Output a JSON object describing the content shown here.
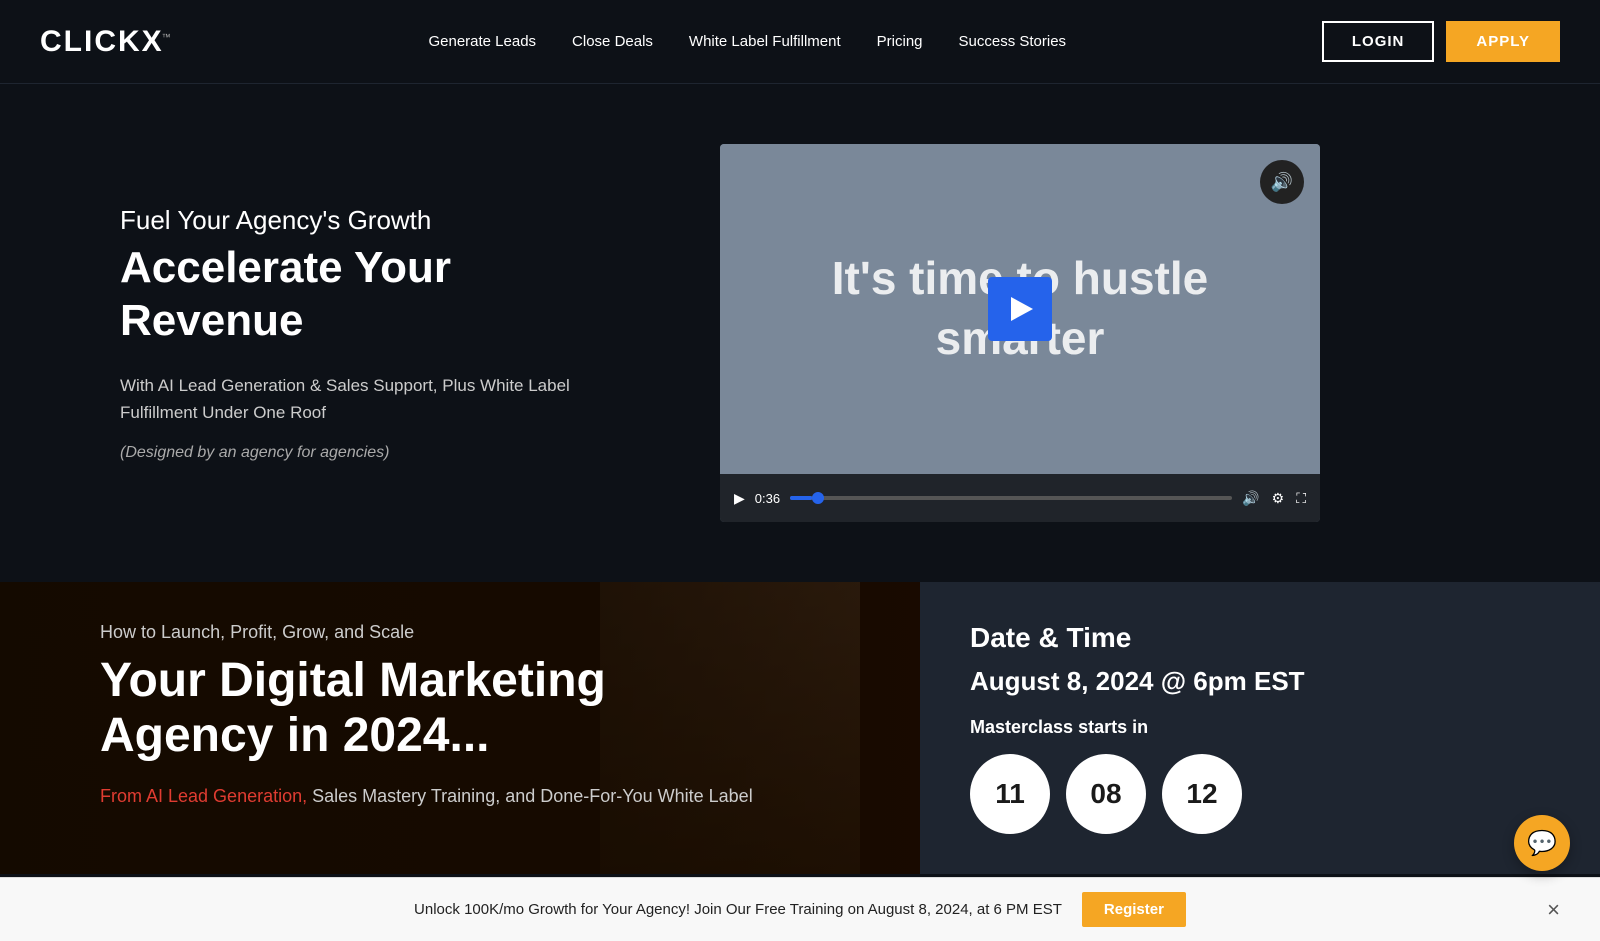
{
  "navbar": {
    "logo": "CLICKX",
    "logo_tm": "™",
    "nav_links": [
      {
        "label": "Generate Leads",
        "id": "generate-leads"
      },
      {
        "label": "Close Deals",
        "id": "close-deals"
      },
      {
        "label": "White Label Fulfillment",
        "id": "white-label"
      },
      {
        "label": "Pricing",
        "id": "pricing"
      },
      {
        "label": "Success Stories",
        "id": "success-stories"
      }
    ],
    "login_label": "LOGIN",
    "apply_label": "APPLY"
  },
  "hero": {
    "subtitle": "Fuel Your Agency's Growth",
    "title": "Accelerate Your Revenue",
    "description": "With AI Lead Generation & Sales Support, Plus White Label Fulfillment Under One Roof",
    "tagline": "(Designed by an agency for agencies)"
  },
  "video": {
    "text_line1": "It's time to hustle",
    "text_line2": "smarter",
    "time": "0:36",
    "mute_icon": "🔊"
  },
  "lower": {
    "pre_title": "How to Launch, Profit, Grow, and Scale",
    "main_title_line1": "Your Digital Marketing",
    "main_title_line2": "Agency in 2024...",
    "highlight_text": "From AI Lead Generation,",
    "sub_text": " Sales Mastery Training, and Done-For-You White Label"
  },
  "countdown": {
    "date_title": "Date & Time",
    "date_value": "August 8, 2024 @ 6pm EST",
    "starts_label": "Masterclass starts in",
    "hours": "11",
    "minutes": "08",
    "seconds": "12"
  },
  "bottom_bar": {
    "text": "Unlock 100K/mo Growth for Your Agency! Join Our Free Training on August 8, 2024, at 6 PM EST",
    "register_label": "Register",
    "close_icon": "×"
  },
  "chat": {
    "icon": "💬"
  }
}
